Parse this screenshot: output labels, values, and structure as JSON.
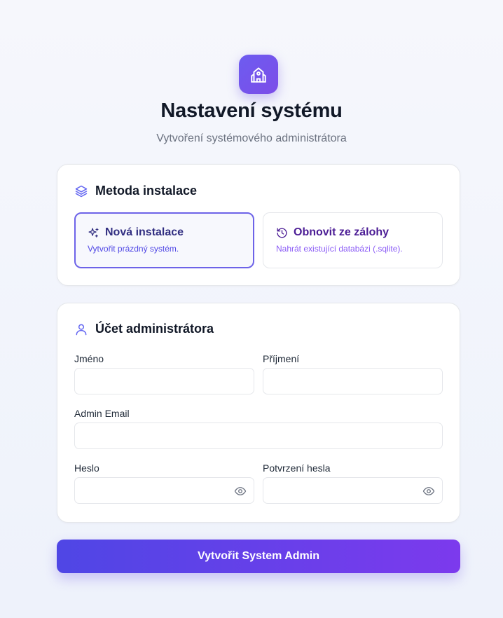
{
  "header": {
    "logo_icon": "building-icon",
    "title": "Nastavení systému",
    "subtitle": "Vytvoření systémového administrátora"
  },
  "method": {
    "icon": "layers-icon",
    "title": "Metoda instalace",
    "selected": "new",
    "options": [
      {
        "id": "new",
        "icon": "sparkles-icon",
        "title": "Nová instalace",
        "description": "Vytvořit prázdný systém."
      },
      {
        "id": "restore",
        "icon": "history-icon",
        "title": "Obnovit ze zálohy",
        "description": "Nahrát existující databázi (.sqlite)."
      }
    ]
  },
  "admin": {
    "icon": "user-icon",
    "title": "Účet administrátora",
    "fields": {
      "first_name": {
        "label": "Jméno",
        "value": ""
      },
      "last_name": {
        "label": "Příjmení",
        "value": ""
      },
      "email": {
        "label": "Admin Email",
        "value": ""
      },
      "password": {
        "label": "Heslo",
        "value": ""
      },
      "password_confirm": {
        "label": "Potvrzení hesla",
        "value": ""
      }
    },
    "toggle_icon": "eye-icon"
  },
  "submit": {
    "label": "Vytvořit System Admin"
  },
  "colors": {
    "accent": "#4f46e5",
    "accent_end": "#7c3aed",
    "selected_border": "#6d63e8"
  }
}
